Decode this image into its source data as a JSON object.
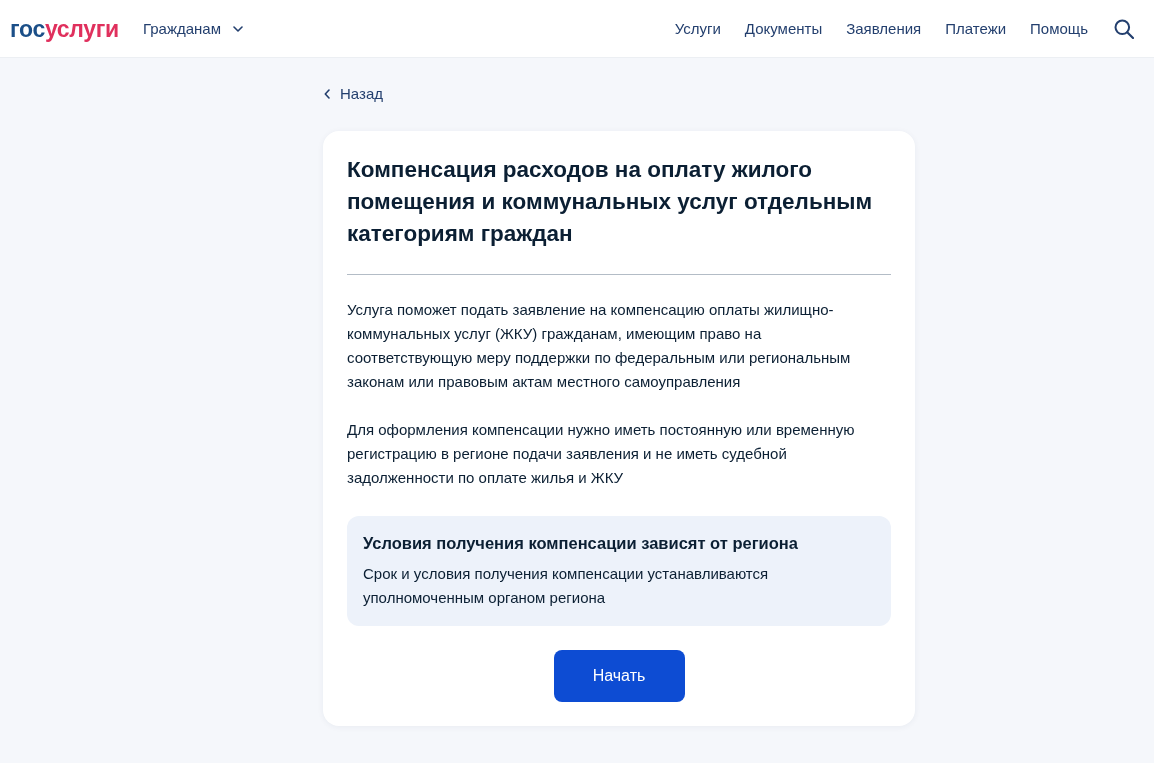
{
  "header": {
    "logo": [
      "гос",
      "услуги"
    ],
    "audience_menu": {
      "label": "Гражданам"
    },
    "nav": [
      "Услуги",
      "Документы",
      "Заявления",
      "Платежи",
      "Помощь"
    ]
  },
  "back_link": {
    "label": "Назад"
  },
  "card": {
    "title": "Компенсация расходов на оплату жилого помещения и коммунальных услуг отдельным категориям граждан",
    "paragraphs": [
      "Услуга поможет подать заявление на компенсацию оплаты жилищно-коммунальных услуг (ЖКУ) гражданам, имеющим право на соответствующую меру поддержки по федеральным или региональным законам или правовым актам местного самоуправления",
      "Для оформления компенсации нужно иметь постоянную или временную регистрацию в регионе подачи заявления и не иметь судебной задолженности по оплате жилья и ЖКУ"
    ],
    "notice": {
      "title": "Условия получения компенсации зависят от региона",
      "text": "Срок и условия получения компенсации устанавливаются уполномоченным органом региона"
    },
    "button": "Начать"
  }
}
